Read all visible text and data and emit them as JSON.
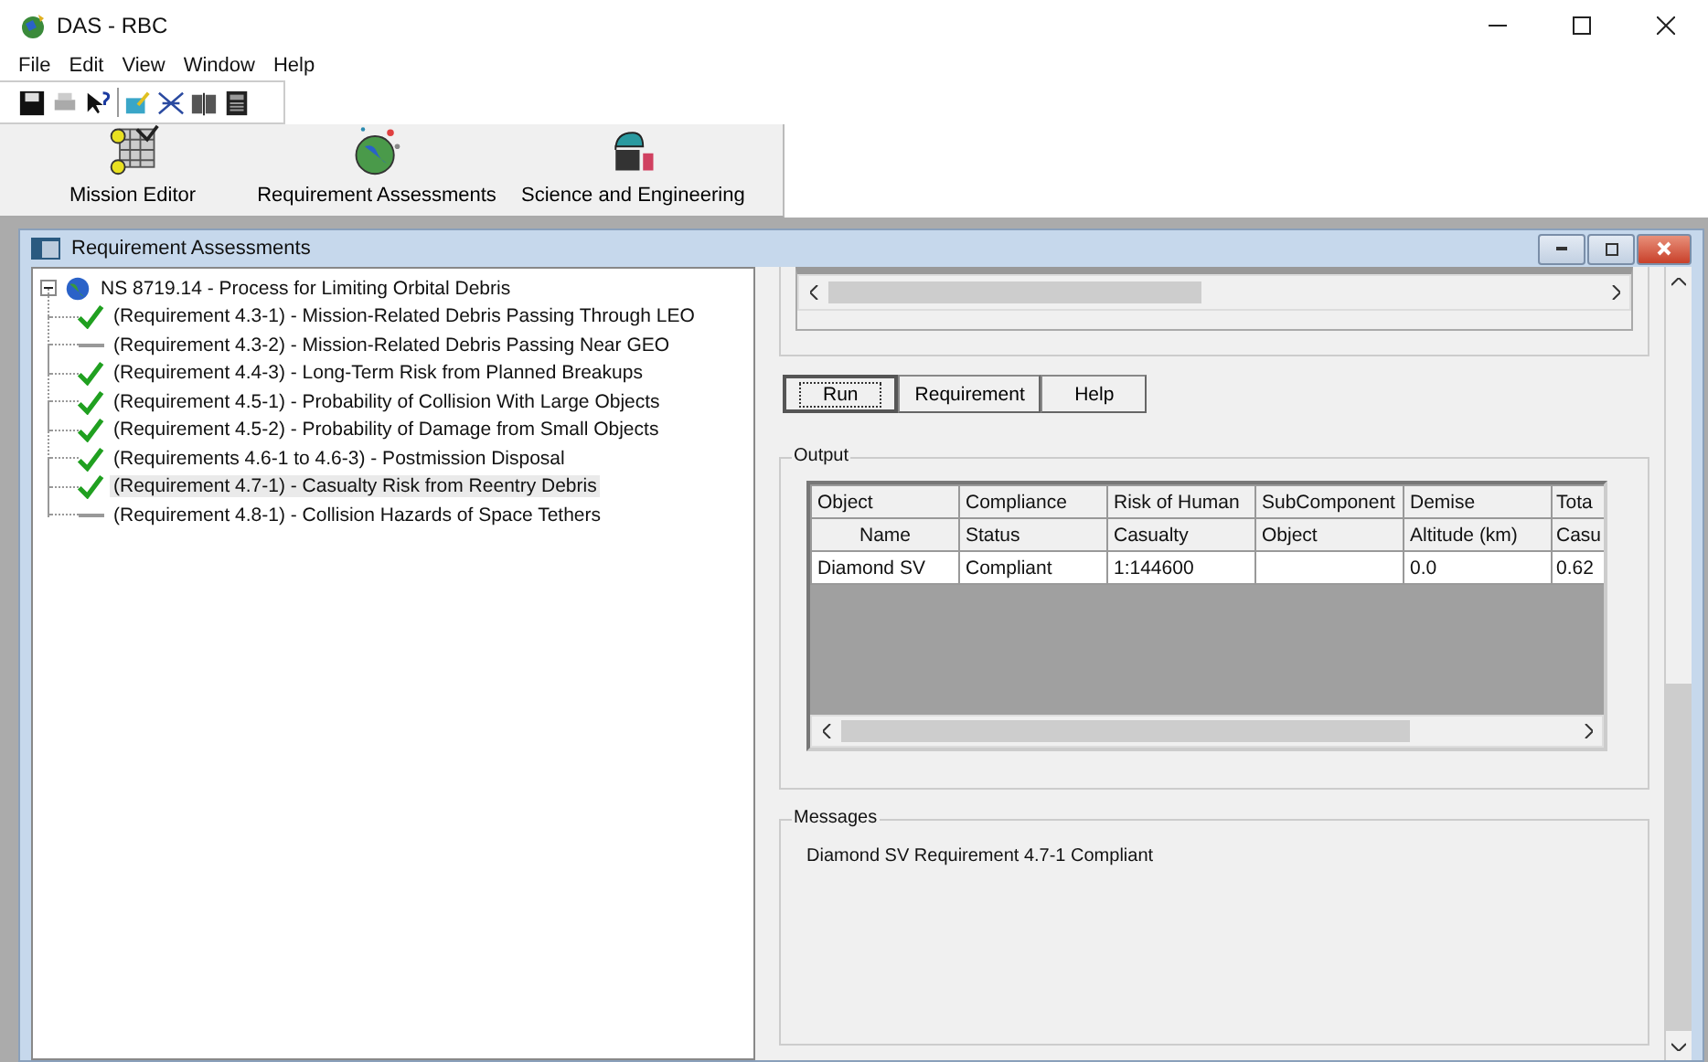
{
  "window": {
    "title": "DAS - RBC"
  },
  "menu": [
    "File",
    "Edit",
    "View",
    "Window",
    "Help"
  ],
  "modules": [
    {
      "label": "Mission Editor"
    },
    {
      "label": "Requirement Assessments"
    },
    {
      "label": "Science and Engineering"
    }
  ],
  "child_window": {
    "title": "Requirement Assessments"
  },
  "tree": {
    "label": "NS 8719.14 - Process for Limiting Orbital Debris",
    "expanded": true,
    "children": [
      {
        "label": "(Requirement 4.3-1) - Mission-Related Debris Passing Through LEO",
        "compliant": true,
        "selected": false
      },
      {
        "label": "(Requirement 4.3-2) - Mission-Related Debris Passing Near GEO",
        "compliant": false,
        "selected": false
      },
      {
        "label": "(Requirement 4.4-3) - Long-Term Risk from Planned Breakups",
        "compliant": true,
        "selected": false
      },
      {
        "label": "(Requirement 4.5-1) - Probability of Collision With Large Objects",
        "compliant": true,
        "selected": false
      },
      {
        "label": "(Requirement 4.5-2) - Probability of Damage from Small Objects",
        "compliant": true,
        "selected": false
      },
      {
        "label": "(Requirements 4.6-1 to 4.6-3) - Postmission Disposal",
        "compliant": true,
        "selected": false
      },
      {
        "label": "(Requirement 4.7-1) - Casualty Risk from Reentry Debris",
        "compliant": true,
        "selected": true
      },
      {
        "label": "(Requirement 4.8-1) - Collision Hazards of Space Tethers",
        "compliant": false,
        "selected": false
      }
    ]
  },
  "actions": [
    {
      "label": "Run",
      "focused": true
    },
    {
      "label": "Requirement",
      "focused": false
    },
    {
      "label": "Help",
      "focused": false
    }
  ],
  "output": {
    "title": "Output",
    "header_rows": [
      [
        "Object",
        "Compliance",
        "Risk of Human",
        "SubComponent",
        "Demise",
        "Tota"
      ],
      [
        "Name",
        "Status",
        "Casualty",
        "Object",
        "Altitude (km)",
        "Casu"
      ]
    ],
    "rows": [
      [
        "Diamond SV",
        "Compliant",
        "1:144600",
        "",
        "0.0",
        "0.62"
      ]
    ]
  },
  "messages": {
    "title": "Messages",
    "lines": [
      "Diamond SV Requirement 4.7-1 Compliant"
    ]
  }
}
